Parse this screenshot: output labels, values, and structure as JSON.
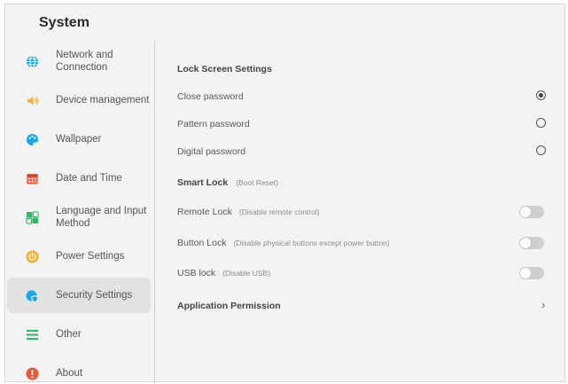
{
  "window": {
    "title": "System"
  },
  "sidebar": {
    "items": [
      {
        "label": "Network and Connection",
        "icon": "globe-icon",
        "color": "#1ea7e0",
        "active": false
      },
      {
        "label": "Device management",
        "icon": "speaker-icon",
        "color": "#f2b133",
        "active": false
      },
      {
        "label": "Wallpaper",
        "icon": "palette-icon",
        "color": "#1ea7e0",
        "active": false
      },
      {
        "label": "Date and Time",
        "icon": "calendar-icon",
        "color": "#e85a3c",
        "active": false
      },
      {
        "label": "Language and Input Method",
        "icon": "language-icon",
        "color": "#33b56a",
        "active": false
      },
      {
        "label": "Power Settings",
        "icon": "power-icon",
        "color": "#f2b133",
        "active": false
      },
      {
        "label": "Security Settings",
        "icon": "shield-icon",
        "color": "#1ea7e0",
        "active": true
      },
      {
        "label": "Other",
        "icon": "list-icon",
        "color": "#33b56a",
        "active": false
      },
      {
        "label": "About",
        "icon": "info-icon",
        "color": "#e85a3c",
        "active": false
      }
    ]
  },
  "main": {
    "lock_screen": {
      "title": "Lock Screen Settings",
      "options": [
        {
          "label": "Close password",
          "selected": true
        },
        {
          "label": "Pattern password",
          "selected": false
        },
        {
          "label": "Digital password",
          "selected": false
        }
      ]
    },
    "smart_lock": {
      "title": "Smart Lock",
      "hint": "(Boot Reset)",
      "items": [
        {
          "label": "Remote Lock",
          "hint": "(Disable remote control)",
          "enabled": false
        },
        {
          "label": "Button Lock",
          "hint": "(Disable physical buttons except power button)",
          "enabled": false
        },
        {
          "label": "USB lock",
          "hint": "(Disable USB)",
          "enabled": false
        }
      ]
    },
    "app_permission": {
      "title": "Application Permission"
    }
  }
}
